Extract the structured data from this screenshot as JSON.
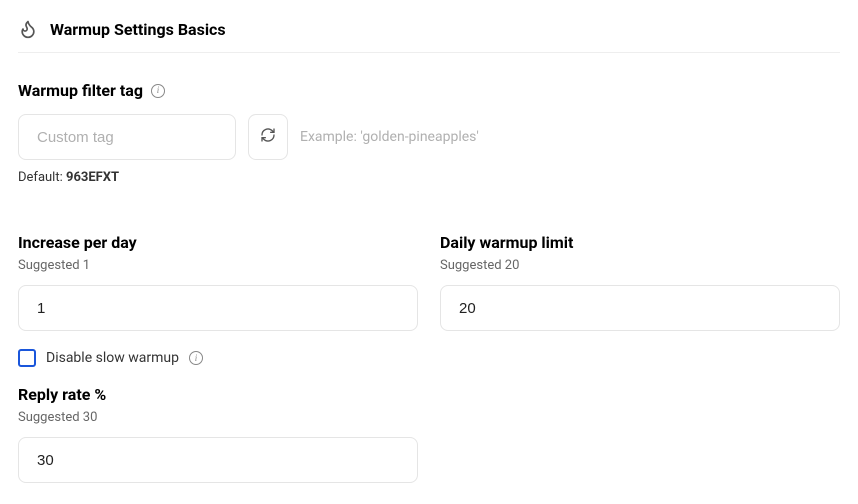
{
  "section": {
    "title": "Warmup Settings Basics"
  },
  "filter": {
    "label": "Warmup filter tag",
    "input_value": "",
    "input_placeholder": "Custom tag",
    "example_text": "Example: 'golden-pineapples'",
    "default_label": "Default: ",
    "default_value": "963EFXT"
  },
  "increase": {
    "label": "Increase per day",
    "suggested_text": "Suggested 1",
    "value": "1"
  },
  "limit": {
    "label": "Daily warmup limit",
    "suggested_text": "Suggested 20",
    "value": "20"
  },
  "disable_slow": {
    "label": "Disable slow warmup",
    "checked": false
  },
  "reply": {
    "label": "Reply rate %",
    "suggested_text": "Suggested 30",
    "value": "30"
  }
}
